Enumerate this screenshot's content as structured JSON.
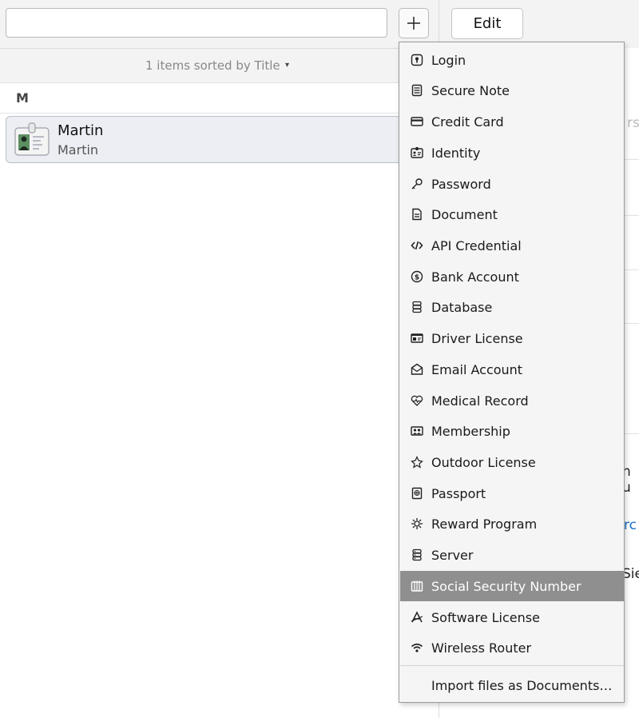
{
  "toolbar": {
    "search": {
      "value": "",
      "placeholder": ""
    },
    "add_icon": "plus-icon",
    "edit_label": "Edit"
  },
  "list": {
    "sort_label": "1 items sorted by Title",
    "sort_caret": "▾",
    "section": "M",
    "items": [
      {
        "title": "Martin",
        "subtitle": "Martin",
        "icon": "identity-card-icon",
        "selected": true
      }
    ]
  },
  "detail_partial": {
    "text_1": "rs",
    "text_2": "n u",
    "text_3": "rc",
    "text_4": "Sie",
    "link_color": "#1a6fc4"
  },
  "menu": {
    "items": [
      {
        "label": "Login",
        "icon": "login-icon"
      },
      {
        "label": "Secure Note",
        "icon": "secure-note-icon"
      },
      {
        "label": "Credit Card",
        "icon": "credit-card-icon"
      },
      {
        "label": "Identity",
        "icon": "identity-icon"
      },
      {
        "label": "Password",
        "icon": "key-icon"
      },
      {
        "label": "Document",
        "icon": "document-icon"
      },
      {
        "label": "API Credential",
        "icon": "code-icon"
      },
      {
        "label": "Bank Account",
        "icon": "dollar-coin-icon"
      },
      {
        "label": "Database",
        "icon": "database-icon"
      },
      {
        "label": "Driver License",
        "icon": "driver-license-icon"
      },
      {
        "label": "Email Account",
        "icon": "envelope-icon"
      },
      {
        "label": "Medical Record",
        "icon": "heart-pulse-icon"
      },
      {
        "label": "Membership",
        "icon": "membership-icon"
      },
      {
        "label": "Outdoor License",
        "icon": "outdoor-icon"
      },
      {
        "label": "Passport",
        "icon": "passport-icon"
      },
      {
        "label": "Reward Program",
        "icon": "reward-icon"
      },
      {
        "label": "Server",
        "icon": "server-icon"
      },
      {
        "label": "Social Security Number",
        "icon": "ssn-icon",
        "highlighted": true
      },
      {
        "label": "Software License",
        "icon": "software-icon"
      },
      {
        "label": "Wireless Router",
        "icon": "wifi-icon"
      }
    ],
    "import_label": "Import files as Documents…",
    "highlight_color": "#8f8f8f"
  }
}
